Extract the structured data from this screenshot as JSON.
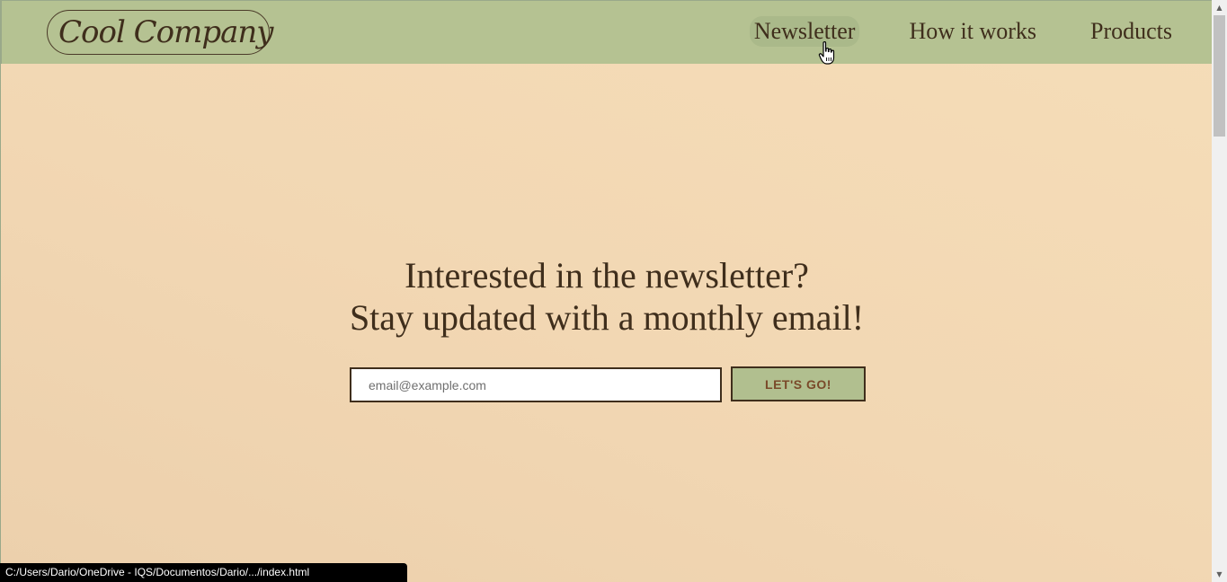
{
  "header": {
    "logo_text": "Cool Company",
    "nav": [
      {
        "label": "Newsletter"
      },
      {
        "label": "How it works"
      },
      {
        "label": "Products"
      }
    ]
  },
  "hero": {
    "line1": "Interested in the newsletter?",
    "line2": "Stay updated with a monthly email!"
  },
  "form": {
    "email_placeholder": "email@example.com",
    "email_value": "",
    "submit_label": "LET'S GO!"
  },
  "status_bar": {
    "url": "C:/Users/Dario/OneDrive - IQS/Documentos/Dario/.../index.html"
  },
  "icons": {
    "logo": "sprout-icon",
    "cursor": "hand-pointer-icon",
    "scroll_up": "triangle-up-icon",
    "scroll_down": "triangle-down-icon"
  },
  "colors": {
    "navbar": "#b5c292",
    "background": "#f2d7b3",
    "text": "#3f2e1c",
    "button": "#b1bf8f",
    "button_text": "#7a4a2a"
  }
}
